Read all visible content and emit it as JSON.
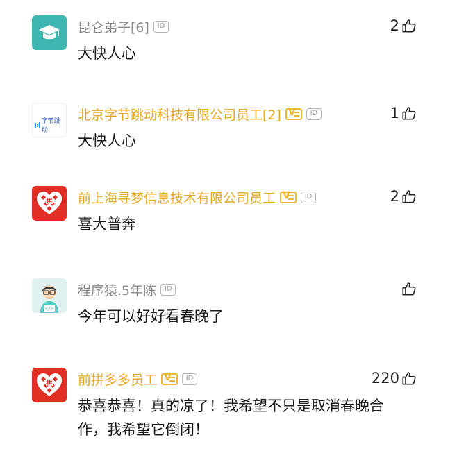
{
  "comments": [
    {
      "avatar": "graduation-cap-icon",
      "name": "昆仑弟子[6]",
      "verified": false,
      "id_badge": "ID",
      "likes": "2",
      "text": "大快人心"
    },
    {
      "avatar": "bytedance-logo",
      "avatar_logo_text": "字节跳动",
      "name": "北京字节跳动科技有限公司员工[2]",
      "verified": true,
      "id_badge": "ID",
      "likes": "1",
      "text": "大快人心"
    },
    {
      "avatar": "pinduoduo-logo",
      "name": "前上海寻梦信息技术有限公司员工",
      "verified": true,
      "id_badge": "ID",
      "likes": "2",
      "text": "喜大普奔"
    },
    {
      "avatar": "programmer-icon",
      "name": "程序猿.5年陈",
      "verified": false,
      "id_badge": "ID",
      "likes": "",
      "text": "今年可以好好看春晚了"
    },
    {
      "avatar": "pinduoduo-logo",
      "name": "前拼多多员工",
      "verified": true,
      "id_badge": "ID",
      "likes": "220",
      "text_line1": "恭喜恭喜！真的凉了！我希望不只是取消春晚合",
      "text_line2": "作，我希望它倒闭！"
    }
  ],
  "colors": {
    "verified_name": "#e6a61e",
    "normal_name": "#8a8a8a",
    "teal_avatar": "#3fb5b0",
    "pdd_red": "#e02e24"
  }
}
